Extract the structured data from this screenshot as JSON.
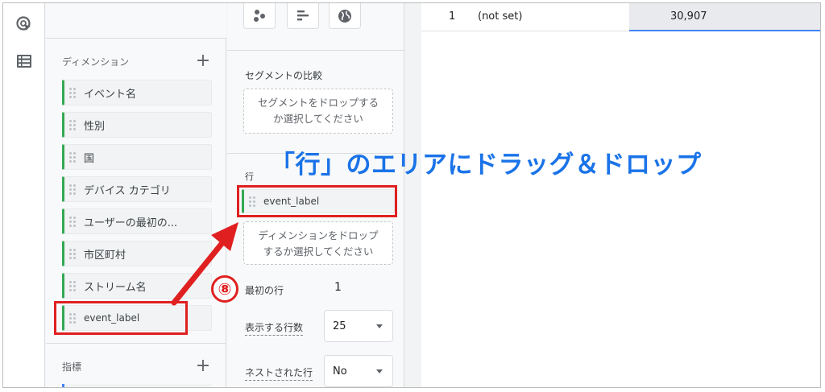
{
  "dimensions": {
    "header": "ディメンション",
    "add_symbol": "+",
    "items": [
      "イベント名",
      "性別",
      "国",
      "デバイス カテゴリ",
      "ユーザーの最初の...",
      "市区町村",
      "ストリーム名",
      "event_label"
    ]
  },
  "metrics": {
    "header": "指標",
    "add_symbol": "+"
  },
  "settings": {
    "segment_compare_label": "セグメントの比較",
    "segment_drop_line1": "セグメントをドロップする",
    "segment_drop_line2": "か選択してください",
    "rows_label": "行",
    "row_chip": "event_label",
    "dimension_drop_line1": "ディメンションをドロップ",
    "dimension_drop_line2": "するか選択してください",
    "first_row_label": "最初の行",
    "first_row_value": "1",
    "rows_shown_label": "表示する行数",
    "rows_shown_value": "25",
    "nested_rows_label": "ネストされた行",
    "nested_rows_value": "No"
  },
  "table": {
    "rows": [
      {
        "index": "1",
        "dimension": "(not set)",
        "value": "30,907"
      }
    ]
  },
  "annotations": {
    "callout": "「行」のエリアにドラッグ＆ドロップ",
    "step": "⑧",
    "color_red": "#e02020",
    "color_blue": "#1a73e8"
  },
  "icons": [
    "explore-cursor-icon",
    "table-list-icon",
    "scatter-viz-icon",
    "bar-viz-icon",
    "globe-viz-icon",
    "drag-grip-icon",
    "dropdown-caret-icon"
  ],
  "colors": {
    "dimension_accent": "#34a853",
    "metric_accent": "#4285f4"
  }
}
